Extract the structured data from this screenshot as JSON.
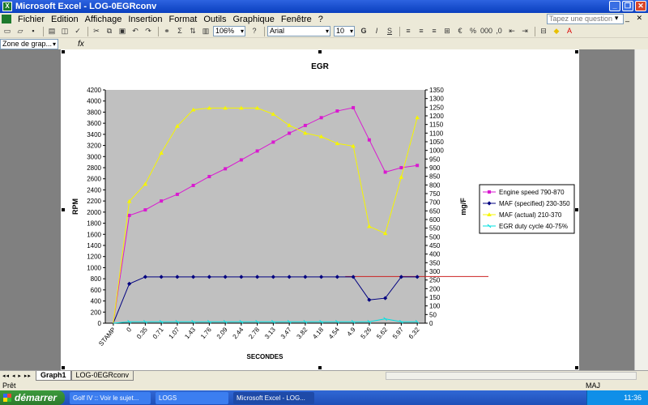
{
  "window": {
    "title": "Microsoft Excel - LOG-0EGRconv",
    "buttons": [
      "_",
      "❐",
      "✕"
    ]
  },
  "menu": {
    "items": [
      "Fichier",
      "Edition",
      "Affichage",
      "Insertion",
      "Format",
      "Outils",
      "Graphique",
      "Fenêtre",
      "?"
    ],
    "help_placeholder": "Tapez une question"
  },
  "toolbar": {
    "zoom": "106%",
    "font": "Arial",
    "size": "10",
    "icons": [
      "new-icon",
      "open-icon",
      "save-icon",
      "print-icon",
      "preview-icon",
      "spell-icon",
      "cut-icon",
      "copy-icon",
      "paste-icon",
      "undo-icon",
      "redo-icon",
      "hyperlink-icon",
      "sum-icon",
      "sort-icon",
      "chart-icon",
      "bold-icon",
      "italic-icon",
      "underline-icon",
      "align-icon",
      "currency-icon",
      "percent-icon",
      "border-icon",
      "fill-color-icon",
      "font-color-icon"
    ]
  },
  "formula_bar": {
    "name_box": "Zone de grap...",
    "fx_label": "fx"
  },
  "chart_data": {
    "type": "line",
    "title": "EGR",
    "xlabel": "SECONDES",
    "ylabel": "RPM",
    "y2label": "mg/F",
    "categories": [
      "STAMP",
      "0",
      "0.35",
      "0.71",
      "1.07",
      "1.43",
      "1.76",
      "2.09",
      "2.44",
      "2.78",
      "3.13",
      "3.47",
      "3.82",
      "4.18",
      "4.54",
      "4.9",
      "5.26",
      "5.62",
      "5.97",
      "6.32"
    ],
    "ylim": [
      0,
      4200
    ],
    "y2lim": [
      0,
      1350
    ],
    "yticks": [
      0,
      200,
      400,
      600,
      800,
      1000,
      1200,
      1400,
      1600,
      1800,
      2000,
      2200,
      2400,
      2600,
      2800,
      3000,
      3200,
      3400,
      3600,
      3800,
      4000,
      4200
    ],
    "y2ticks": [
      0,
      50,
      100,
      150,
      200,
      250,
      300,
      350,
      400,
      450,
      500,
      550,
      600,
      650,
      700,
      750,
      800,
      850,
      900,
      950,
      1000,
      1050,
      1100,
      1150,
      1200,
      1250,
      1300,
      1350
    ],
    "series": [
      {
        "name": "Engine speed 790-870",
        "axis": "primary",
        "color": "#d91ad0",
        "marker": "square",
        "values": [
          0,
          1940,
          2040,
          2200,
          2320,
          2480,
          2640,
          2780,
          2940,
          3100,
          3260,
          3420,
          3560,
          3700,
          3820,
          3880,
          3300,
          2720,
          2800,
          2840
        ]
      },
      {
        "name": "MAF (specified) 230-350",
        "axis": "secondary",
        "color": "#000080",
        "marker": "diamond",
        "values": [
          0,
          228,
          268,
          268,
          268,
          268,
          268,
          268,
          268,
          268,
          268,
          268,
          268,
          268,
          268,
          268,
          135,
          145,
          268,
          268
        ]
      },
      {
        "name": "MAF (actual) 210-370",
        "axis": "secondary",
        "color": "#f5f500",
        "marker": "triangle",
        "values": [
          0,
          705,
          805,
          985,
          1140,
          1235,
          1245,
          1245,
          1245,
          1245,
          1210,
          1145,
          1100,
          1080,
          1040,
          1025,
          560,
          520,
          845,
          1190
        ]
      },
      {
        "name": "EGR duty cycle 40-75%",
        "axis": "secondary",
        "color": "#00e0e0",
        "marker": "x",
        "values": [
          0,
          8,
          8,
          8,
          8,
          8,
          8,
          8,
          8,
          8,
          8,
          8,
          8,
          8,
          8,
          8,
          8,
          25,
          8,
          8
        ]
      }
    ],
    "reference_line": {
      "axis": "primary",
      "value": 840,
      "color": "#cc2222"
    },
    "plot_background": "#c0c0c0",
    "grid": false,
    "legend_position": "right"
  },
  "sheets": {
    "tabs": [
      "Graph1",
      "LOG-0EGRconv"
    ],
    "active": "Graph1"
  },
  "status": {
    "left": "Prêt",
    "right": "MAJ"
  },
  "taskbar": {
    "start": "démarrer",
    "tasks": [
      "Golf IV :: Voir le sujet...",
      "LOGS",
      "Microsoft Excel - LOG..."
    ],
    "clock": "11:36"
  }
}
